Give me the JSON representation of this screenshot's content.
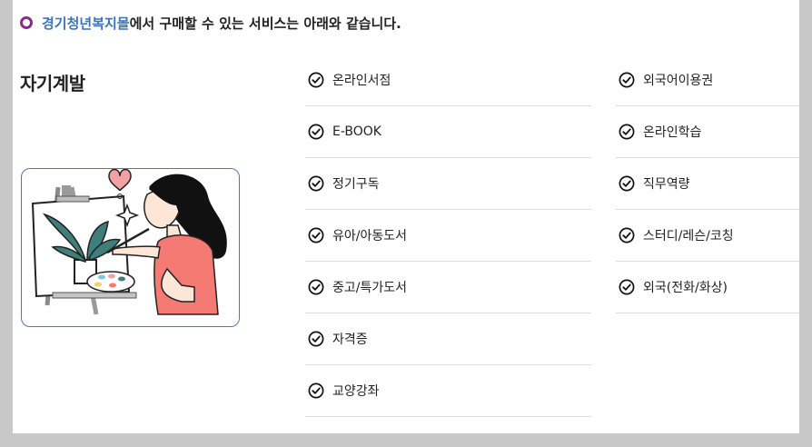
{
  "intro": {
    "brand": "경기청년복지몰",
    "text": "에서 구매할 수 있는 서비스는 아래와 같습니다."
  },
  "section": {
    "title": "자기계발"
  },
  "colors": {
    "brand": "#3b74b9",
    "bullet": "#8a2b86",
    "illustration_border": "#4a79b9"
  },
  "services": {
    "col1": [
      {
        "label": "온라인서점",
        "icon": "check-circle-icon"
      },
      {
        "label": "E-BOOK",
        "icon": "check-circle-icon"
      },
      {
        "label": "정기구독",
        "icon": "check-circle-icon"
      },
      {
        "label": "유아/아동도서",
        "icon": "check-circle-icon"
      },
      {
        "label": "중고/특가도서",
        "icon": "check-circle-icon"
      },
      {
        "label": "자격증",
        "icon": "check-circle-icon"
      },
      {
        "label": "교양강좌",
        "icon": "check-circle-icon"
      }
    ],
    "col2": [
      {
        "label": "외국어이용권",
        "icon": "check-circle-icon"
      },
      {
        "label": "온라인학습",
        "icon": "check-circle-icon"
      },
      {
        "label": "직무역량",
        "icon": "check-circle-icon"
      },
      {
        "label": "스터디/레슨/코칭",
        "icon": "check-circle-icon"
      },
      {
        "label": "외국(전화/화상)",
        "icon": "check-circle-icon"
      }
    ]
  }
}
